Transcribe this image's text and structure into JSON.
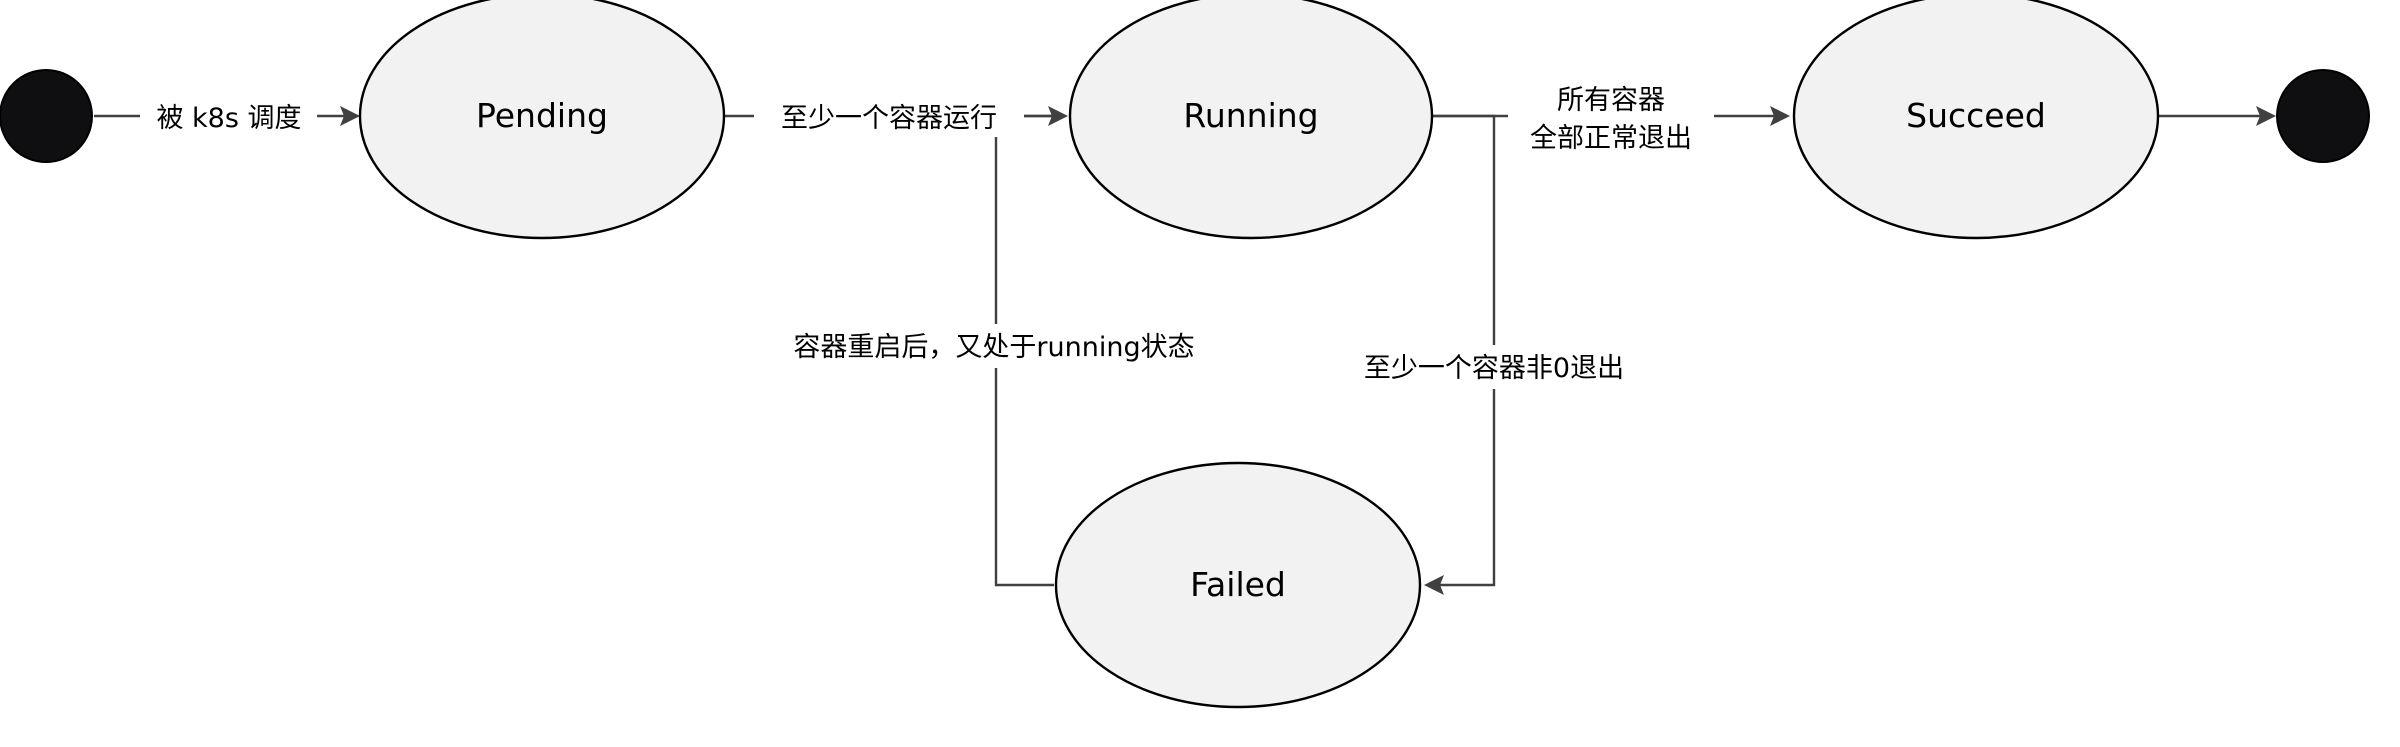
{
  "diagram": {
    "states": {
      "pending": "Pending",
      "running": "Running",
      "succeed": "Succeed",
      "failed": "Failed"
    },
    "transitions": {
      "start_to_pending": "被 k8s 调度",
      "pending_to_running": "至少一个容器运行",
      "running_to_succeed_line1": "所有容器",
      "running_to_succeed_line2": "全部正常退出",
      "running_to_failed": "至少一个容器非0退出",
      "failed_to_running": "容器重启后，又处于running状态"
    },
    "colors": {
      "state_fill": "#f2f2f2",
      "terminal_fill": "#0f0f12",
      "edge": "#404040"
    }
  }
}
